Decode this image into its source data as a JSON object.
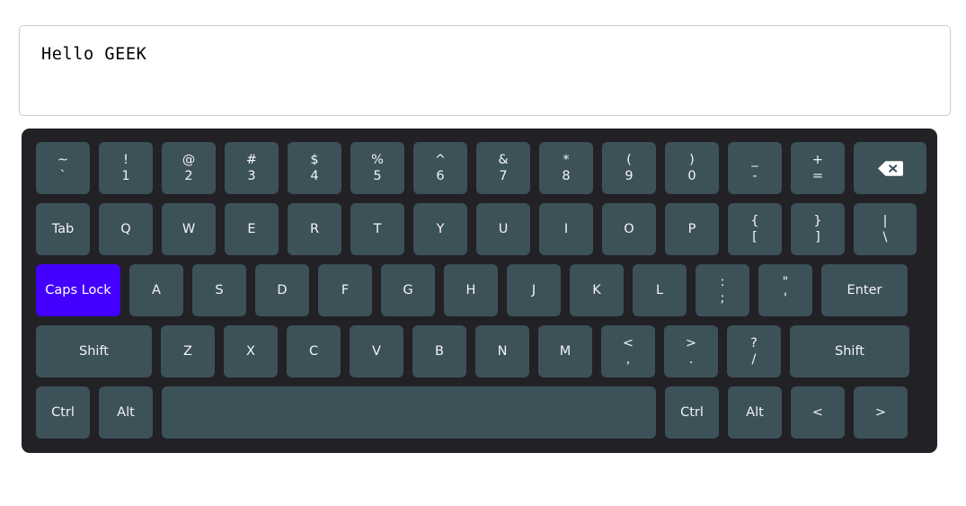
{
  "display": {
    "value": "Hello GEEK",
    "placeholder": ""
  },
  "colors": {
    "page_background": "#ffffff",
    "keyboard_background": "#212126",
    "key_background": "#3d5159",
    "key_text": "#f2f4f5",
    "active_key_background": "#4400ff",
    "active_key_text": "#ffffff",
    "display_border": "#cccccc"
  },
  "keyboard": {
    "active_keys": [
      "Caps Lock"
    ],
    "rows": [
      {
        "name": "number-row",
        "keys": [
          {
            "name": "backquote",
            "top": "~",
            "bottom": "`",
            "size": "w-tab"
          },
          {
            "name": "digit-1",
            "top": "!",
            "bottom": "1",
            "size": "w-tab"
          },
          {
            "name": "digit-2",
            "top": "@",
            "bottom": "2",
            "size": "w-tab"
          },
          {
            "name": "digit-3",
            "top": "#",
            "bottom": "3",
            "size": "w-tab"
          },
          {
            "name": "digit-4",
            "top": "$",
            "bottom": "4",
            "size": "w-tab"
          },
          {
            "name": "digit-5",
            "top": "%",
            "bottom": "5",
            "size": "w-tab"
          },
          {
            "name": "digit-6",
            "top": "^",
            "bottom": "6",
            "size": "w-tab"
          },
          {
            "name": "digit-7",
            "top": "&",
            "bottom": "7",
            "size": "w-tab"
          },
          {
            "name": "digit-8",
            "top": "*",
            "bottom": "8",
            "size": "w-tab"
          },
          {
            "name": "digit-9",
            "top": "(",
            "bottom": "9",
            "size": "w-tab"
          },
          {
            "name": "digit-0",
            "top": ")",
            "bottom": "0",
            "size": "w-tab"
          },
          {
            "name": "minus",
            "top": "_",
            "bottom": "-",
            "size": "w-tab"
          },
          {
            "name": "equal",
            "top": "+",
            "bottom": "=",
            "size": "w-tab"
          },
          {
            "name": "backspace",
            "icon": "backspace-icon",
            "size": "w-bksp"
          }
        ]
      },
      {
        "name": "tab-row",
        "keys": [
          {
            "name": "tab",
            "label": "Tab",
            "size": "w-tab"
          },
          {
            "name": "key-q",
            "label": "Q",
            "size": "w-tab"
          },
          {
            "name": "key-w",
            "label": "W",
            "size": "w-tab"
          },
          {
            "name": "key-e",
            "label": "E",
            "size": "w-tab"
          },
          {
            "name": "key-r",
            "label": "R",
            "size": "w-tab"
          },
          {
            "name": "key-t",
            "label": "T",
            "size": "w-tab"
          },
          {
            "name": "key-y",
            "label": "Y",
            "size": "w-tab"
          },
          {
            "name": "key-u",
            "label": "U",
            "size": "w-tab"
          },
          {
            "name": "key-i",
            "label": "I",
            "size": "w-tab"
          },
          {
            "name": "key-o",
            "label": "O",
            "size": "w-tab"
          },
          {
            "name": "key-p",
            "label": "P",
            "size": "w-tab"
          },
          {
            "name": "bracket-left",
            "top": "{",
            "bottom": "[",
            "size": "w-tab"
          },
          {
            "name": "bracket-right",
            "top": "}",
            "bottom": "]",
            "size": "w-tab"
          },
          {
            "name": "backslash",
            "top": "|",
            "bottom": "\\",
            "size": "w-pipe"
          }
        ]
      },
      {
        "name": "home-row",
        "keys": [
          {
            "name": "caps-lock",
            "label": "Caps Lock",
            "size": "w-caps",
            "active": true
          },
          {
            "name": "key-a",
            "label": "A",
            "size": "w-tab"
          },
          {
            "name": "key-s",
            "label": "S",
            "size": "w-tab"
          },
          {
            "name": "key-d",
            "label": "D",
            "size": "w-tab"
          },
          {
            "name": "key-f",
            "label": "F",
            "size": "w-tab"
          },
          {
            "name": "key-g",
            "label": "G",
            "size": "w-tab"
          },
          {
            "name": "key-h",
            "label": "H",
            "size": "w-tab"
          },
          {
            "name": "key-j",
            "label": "J",
            "size": "w-tab"
          },
          {
            "name": "key-k",
            "label": "K",
            "size": "w-tab"
          },
          {
            "name": "key-l",
            "label": "L",
            "size": "w-tab"
          },
          {
            "name": "semicolon",
            "top": ":",
            "bottom": ";",
            "size": "w-tab"
          },
          {
            "name": "quote",
            "top": "\"",
            "bottom": "'",
            "size": "w-tab"
          },
          {
            "name": "enter",
            "label": "Enter",
            "size": "w-enter"
          }
        ]
      },
      {
        "name": "shift-row",
        "keys": [
          {
            "name": "shift-left",
            "label": "Shift",
            "size": "w-shiftl"
          },
          {
            "name": "key-z",
            "label": "Z",
            "size": "w-tab"
          },
          {
            "name": "key-x",
            "label": "X",
            "size": "w-tab"
          },
          {
            "name": "key-c",
            "label": "C",
            "size": "w-tab"
          },
          {
            "name": "key-v",
            "label": "V",
            "size": "w-tab"
          },
          {
            "name": "key-b",
            "label": "B",
            "size": "w-tab"
          },
          {
            "name": "key-n",
            "label": "N",
            "size": "w-tab"
          },
          {
            "name": "key-m",
            "label": "M",
            "size": "w-tab"
          },
          {
            "name": "comma",
            "top": "<",
            "bottom": ",",
            "size": "w-tab"
          },
          {
            "name": "period",
            "top": ">",
            "bottom": ".",
            "size": "w-tab"
          },
          {
            "name": "slash",
            "top": "?",
            "bottom": "/",
            "size": "w-tab"
          },
          {
            "name": "shift-right",
            "label": "Shift",
            "size": "w-shiftr"
          }
        ]
      },
      {
        "name": "bottom-row",
        "keys": [
          {
            "name": "ctrl-left",
            "label": "Ctrl",
            "size": "w-tab"
          },
          {
            "name": "alt-left",
            "label": "Alt",
            "size": "w-tab"
          },
          {
            "name": "space",
            "label": "",
            "size": "w-space"
          },
          {
            "name": "ctrl-right",
            "label": "Ctrl",
            "size": "w-tab"
          },
          {
            "name": "alt-right",
            "label": "Alt",
            "size": "w-tab"
          },
          {
            "name": "arrow-left",
            "label": "<",
            "size": "w-tab"
          },
          {
            "name": "arrow-right",
            "label": ">",
            "size": "w-tab"
          }
        ]
      }
    ]
  }
}
